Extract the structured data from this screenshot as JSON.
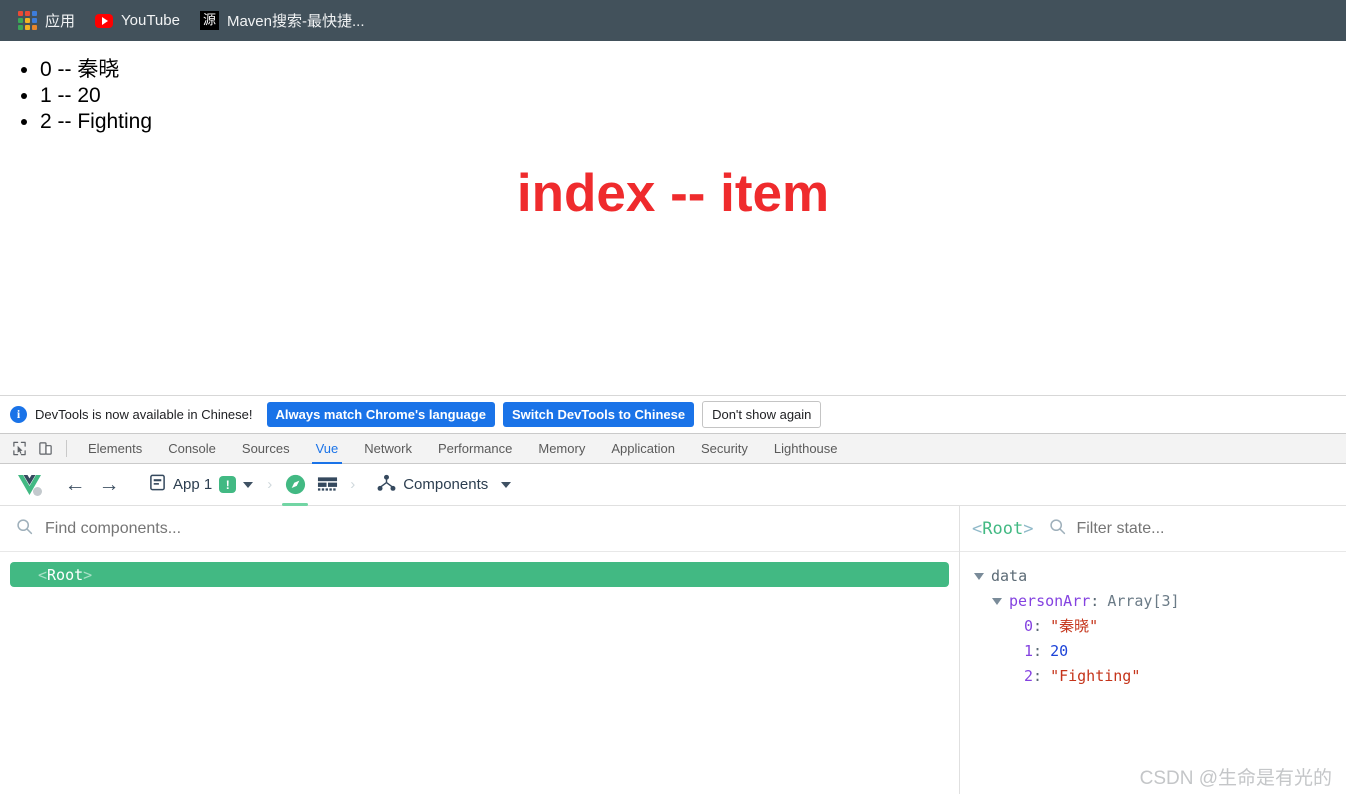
{
  "bookmarks_bar": {
    "background": "#42515b",
    "items": [
      {
        "icon": "apps-grid-icon",
        "label": "应用"
      },
      {
        "icon": "youtube-icon",
        "label": "YouTube"
      },
      {
        "icon": "maven-source-icon",
        "icon_text": "源",
        "label": "Maven搜索-最快捷..."
      }
    ]
  },
  "page": {
    "heading": "index -- item",
    "heading_color": "#ef2b2d",
    "list_items": [
      "0 -- 秦晓",
      "1 -- 20",
      "2 -- Fighting"
    ]
  },
  "devtools_notice": {
    "icon": "info-icon",
    "message": "DevTools is now available in Chinese!",
    "primary_button": "Always match Chrome's language",
    "secondary_button": "Switch DevTools to Chinese",
    "dismiss_button": "Don't show again",
    "accent": "#1a73e8"
  },
  "devtools_tabs": {
    "tools": [
      "inspect-element-icon",
      "device-toolbar-icon"
    ],
    "items": [
      {
        "label": "Elements",
        "active": false
      },
      {
        "label": "Console",
        "active": false
      },
      {
        "label": "Sources",
        "active": false
      },
      {
        "label": "Vue",
        "active": true
      },
      {
        "label": "Network",
        "active": false
      },
      {
        "label": "Performance",
        "active": false
      },
      {
        "label": "Memory",
        "active": false
      },
      {
        "label": "Application",
        "active": false
      },
      {
        "label": "Security",
        "active": false
      },
      {
        "label": "Lighthouse",
        "active": false
      }
    ],
    "active_color": "#1a73e8"
  },
  "vue_toolbar": {
    "logo": "vue-logo-icon",
    "back": "back-arrow-icon",
    "forward": "forward-arrow-icon",
    "app_selector": {
      "icon": "document-icon",
      "label": "App 1",
      "badge": "!",
      "badge_color": "#42b983",
      "chevron": "chevron-down-icon"
    },
    "separator_1": "›",
    "instance_icon": "compass-icon",
    "instance_icon_active": true,
    "grid_icon": "grid-table-icon",
    "separator_2": "›",
    "view_selector": {
      "icon": "component-tree-icon",
      "label": "Components",
      "chevron": "chevron-down-icon"
    }
  },
  "components_panel": {
    "search": {
      "icon": "search-icon",
      "placeholder": "Find components..."
    },
    "tree": [
      {
        "open_bracket": "<",
        "name": "Root",
        "close_bracket": ">",
        "selected": true
      }
    ],
    "selected_color": "#42b983"
  },
  "state_panel": {
    "header": {
      "open_bracket": "<",
      "name": "Root",
      "close_bracket": ">",
      "search_icon": "search-icon",
      "filter_placeholder": "Filter state..."
    },
    "tree": {
      "group_label": "data",
      "property_name": "personArr",
      "property_colon": ":",
      "property_type": "Array[3]",
      "entries": [
        {
          "index": "0",
          "colon": ":",
          "value": "\"秦晓\"",
          "kind": "string"
        },
        {
          "index": "1",
          "colon": ":",
          "value": "20",
          "kind": "number"
        },
        {
          "index": "2",
          "colon": ":",
          "value": "\"Fighting\"",
          "kind": "string"
        }
      ]
    }
  },
  "watermark": "CSDN @生命是有光的"
}
